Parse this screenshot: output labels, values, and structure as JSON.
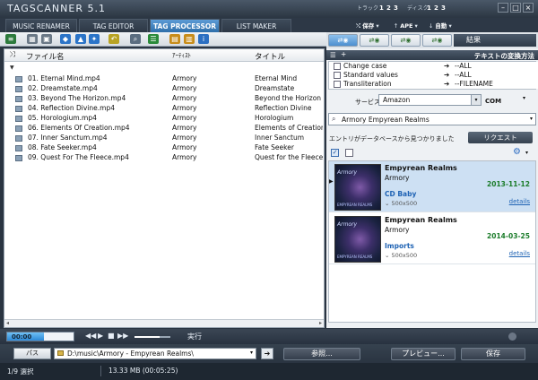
{
  "app": {
    "title": "TAGSCANNER 5.1"
  },
  "header": {
    "track_label": "トラック",
    "track_nums": [
      "1",
      "2",
      "3"
    ],
    "disc_label": "ディスク",
    "disc_nums": [
      "1",
      "2",
      "3"
    ],
    "opt1_a": "保存",
    "opt1_b": "APE",
    "opt1_c": "自動"
  },
  "tabs": [
    {
      "label": "MUSIC RENAMER"
    },
    {
      "label": "TAG EDITOR"
    },
    {
      "label": "TAG PROCESSOR"
    },
    {
      "label": "LIST MAKER"
    }
  ],
  "filelist": {
    "columns": {
      "name": "ファイル名",
      "artist": "ｱｰﾃｨｽﾄ",
      "title": "タイトル"
    },
    "rows": [
      {
        "file": "01. Eternal Mind.mp4",
        "artist": "Armory",
        "title": "Eternal Mind"
      },
      {
        "file": "02. Dreamstate.mp4",
        "artist": "Armory",
        "title": "Dreamstate"
      },
      {
        "file": "03. Beyond The Horizon.mp4",
        "artist": "Armory",
        "title": "Beyond the Horizon"
      },
      {
        "file": "04. Reflection Divine.mp4",
        "artist": "Armory",
        "title": "Reflection Divine"
      },
      {
        "file": "05. Horologium.mp4",
        "artist": "Armory",
        "title": "Horologium"
      },
      {
        "file": "06. Elements Of Creation.mp4",
        "artist": "Armory",
        "title": "Elements of Creation"
      },
      {
        "file": "07. Inner Sanctum.mp4",
        "artist": "Armory",
        "title": "Inner Sanctum"
      },
      {
        "file": "08. Fate Seeker.mp4",
        "artist": "Armory",
        "title": "Fate Seeker"
      },
      {
        "file": "09. Quest For The Fleece.mp4",
        "artist": "Armory",
        "title": "Quest for the Fleece"
      }
    ]
  },
  "panel": {
    "result_tab": "結果",
    "conversion_title": "テキストの変換方法",
    "conversions": [
      {
        "label": "Change case",
        "value": "--ALL"
      },
      {
        "label": "Standard values",
        "value": "--ALL"
      },
      {
        "label": "Transliteration",
        "value": "--FILENAME"
      }
    ],
    "service_label": "サービス",
    "service_value": "Amazon",
    "region": "COM",
    "query": "Armory Empyrean Realms",
    "found_text": "エントリがデータベースから見つかりました",
    "request_label": "リクエスト",
    "results": [
      {
        "title": "Empyrean Realms",
        "artist": "Armory",
        "date": "2013-11-12",
        "label": "CD Baby",
        "size": "500x500",
        "details": "details"
      },
      {
        "title": "Empyrean Realms",
        "artist": "Armory",
        "date": "2014-03-25",
        "label": "Imports",
        "size": "500x500",
        "details": "details"
      }
    ]
  },
  "player": {
    "time": "00:00",
    "exec_label": "実行",
    "progress": 0.55,
    "volume": 0.7
  },
  "pathbar": {
    "label": "パス",
    "path": "D:\\music\\Armory - Empyrean Realms\\",
    "browse": "参照...",
    "preview": "プレビュー...",
    "save": "保存"
  },
  "status": {
    "selection": "1/9 選択",
    "size": "13.33 MB (00:05:25)"
  },
  "colors": {
    "accent": "#2f6faa",
    "date_green": "#1b7c2a",
    "link_blue": "#1f63b4"
  }
}
